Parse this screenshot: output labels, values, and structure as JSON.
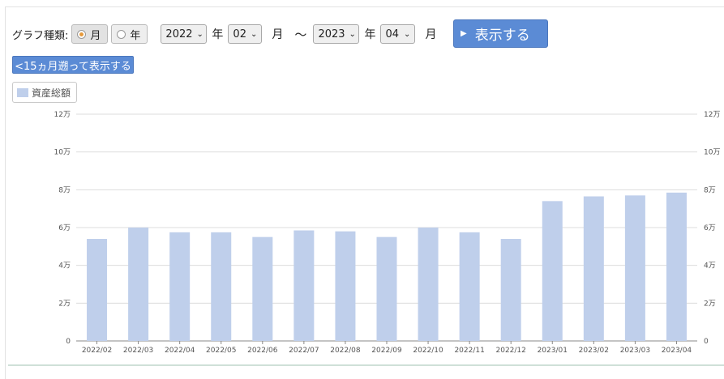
{
  "controls": {
    "graph_type_label": "グラフ種類:",
    "radio_month": "月",
    "radio_year": "年",
    "from_year": "2022",
    "from_month": "02",
    "to_year": "2023",
    "to_month": "04",
    "unit_year": "年",
    "unit_month": "月",
    "tilde": "〜",
    "show_button": "表示する",
    "back_button": "<15ヵ月遡って表示する"
  },
  "legend": {
    "label": "資産総額",
    "color": "#bfcfeb"
  },
  "chart_data": {
    "type": "bar",
    "categories": [
      "2022/02",
      "2022/03",
      "2022/04",
      "2022/05",
      "2022/06",
      "2022/07",
      "2022/08",
      "2022/09",
      "2022/10",
      "2022/11",
      "2022/12",
      "2023/01",
      "2023/02",
      "2023/03",
      "2023/04"
    ],
    "series": [
      {
        "name": "資産総額",
        "values": [
          54000,
          60000,
          57500,
          57500,
          55000,
          58500,
          58000,
          55000,
          60000,
          57500,
          54000,
          74000,
          76500,
          77000,
          78500
        ]
      }
    ],
    "y_ticks": [
      "0",
      "2万",
      "4万",
      "6万",
      "8万",
      "10万",
      "12万"
    ],
    "ylim": [
      0,
      120000
    ],
    "grid": true,
    "bar_color": "#bfcfeb"
  }
}
